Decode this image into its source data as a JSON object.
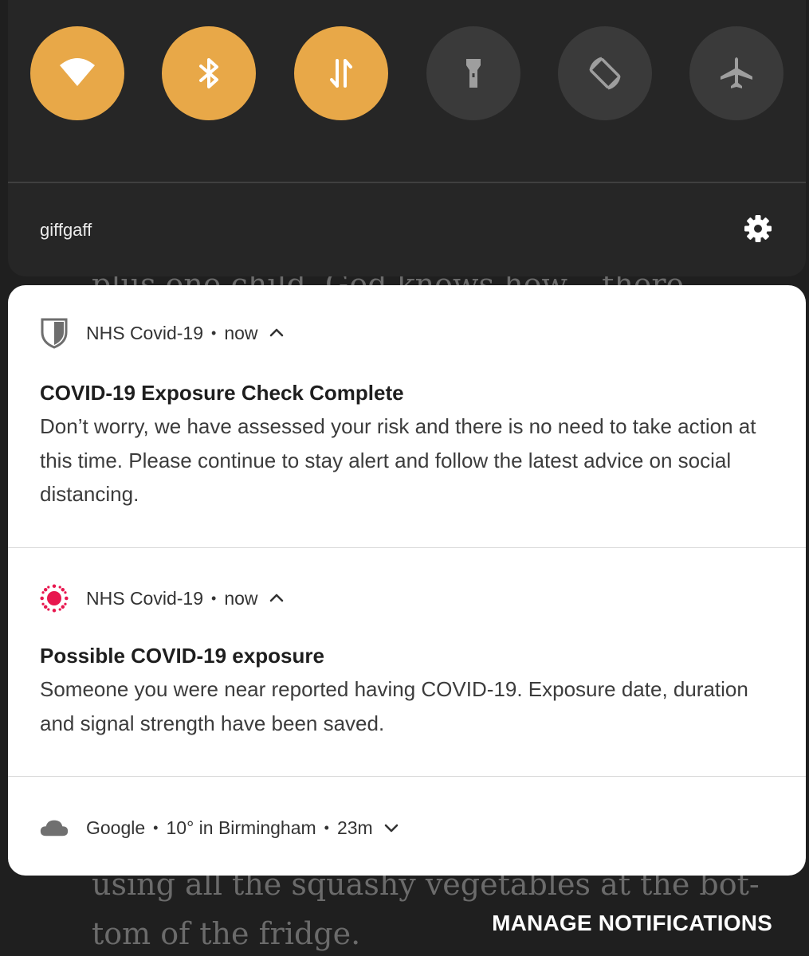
{
  "background": {
    "line1": "plus one child. God knows how – there",
    "line2": "using all the squashy vegetables at the bot-",
    "line3": "tom of the fridge."
  },
  "quick_settings": {
    "tiles": [
      {
        "name": "wifi",
        "icon": "wifi-icon",
        "state": "on"
      },
      {
        "name": "bluetooth",
        "icon": "bluetooth-icon",
        "state": "on"
      },
      {
        "name": "mobile-data",
        "icon": "data-arrows-icon",
        "state": "on"
      },
      {
        "name": "flashlight",
        "icon": "flashlight-icon",
        "state": "off"
      },
      {
        "name": "auto-rotate",
        "icon": "rotate-icon",
        "state": "off"
      },
      {
        "name": "airplane-mode",
        "icon": "airplane-icon",
        "state": "off"
      }
    ],
    "carrier": "giffgaff",
    "colors": {
      "active": "#e8a848",
      "inactive": "#3a3a3a"
    }
  },
  "notifications": [
    {
      "app": "NHS Covid-19",
      "time": "now",
      "icon": "shield-icon",
      "title": "COVID-19 Exposure Check Complete",
      "body": "Don’t worry, we have assessed your risk and there is no need to take action at this time. Please continue to stay alert and follow the latest advice on social distancing."
    },
    {
      "app": "NHS Covid-19",
      "time": "now",
      "icon": "virus-icon",
      "icon_color": "#e8174f",
      "title": "Possible COVID-19 exposure",
      "body": "Someone you were near reported having COVID-19. Exposure date, duration and signal strength have been saved."
    },
    {
      "app": "Google",
      "detail": "10° in Birmingham",
      "time": "23m",
      "icon": "cloud-icon"
    }
  ],
  "manage_label": "MANAGE NOTIFICATIONS"
}
